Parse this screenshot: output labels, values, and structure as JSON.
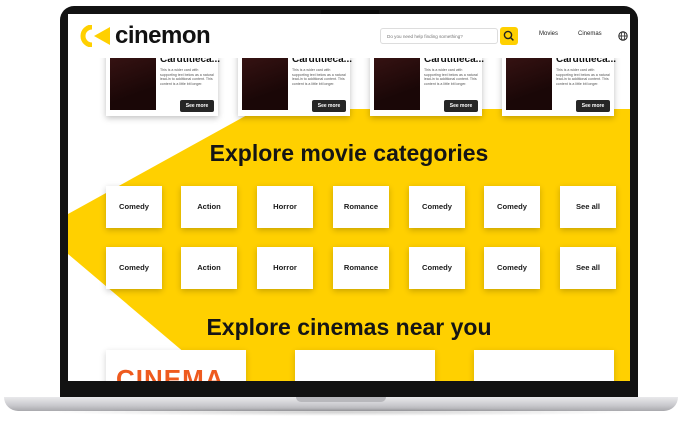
{
  "brand": {
    "name": "cinemon",
    "accent": "#ffd000"
  },
  "header": {
    "search_placeholder": "Do you need help finding something?",
    "nav": [
      "Movies",
      "Cinemas"
    ]
  },
  "cards": [
    {
      "title": "Cardtitleca...",
      "description": "This is a wider card with supporting text below as a natural lead-in to additional content. This content is a little bit longer.",
      "button": "See more"
    },
    {
      "title": "Cardtitleca...",
      "description": "This is a wider card with supporting text below as a natural lead-in to additional content. This content is a little bit longer.",
      "button": "See more"
    },
    {
      "title": "Cardtitleca...",
      "description": "This is a wider card with supporting text below as a natural lead-in to additional content. This content is a little bit longer.",
      "button": "See more"
    },
    {
      "title": "Cardtitleca...",
      "description": "This is a wider card with supporting text below as a natural lead-in to additional content. This content is a little bit longer.",
      "button": "See more"
    }
  ],
  "categories": {
    "heading": "Explore movie categories",
    "row1": [
      "Comedy",
      "Action",
      "Horror",
      "Romance",
      "Comedy",
      "Comedy",
      "See all"
    ],
    "row2": [
      "Comedy",
      "Action",
      "Horror",
      "Romance",
      "Comedy",
      "Comedy",
      "See all"
    ]
  },
  "cinemas": {
    "heading": "Explore cinemas near you",
    "logo_text": "CINEMA"
  }
}
